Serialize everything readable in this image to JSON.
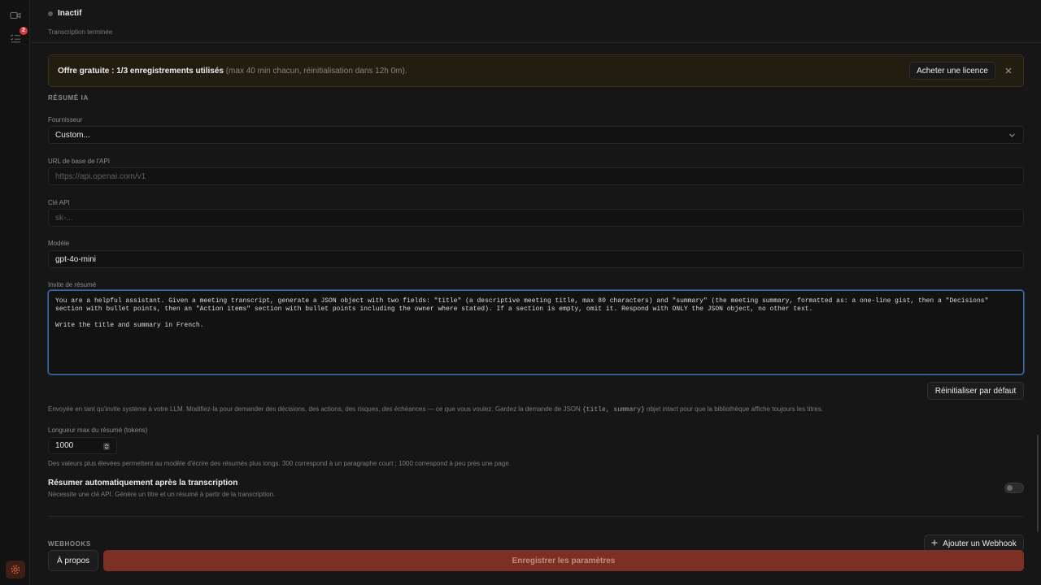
{
  "rail": {
    "icons": [
      "video-icon",
      "list-checks-icon",
      "settings-icon"
    ],
    "badge_count": "2"
  },
  "status": {
    "label": "Inactif",
    "sub": "Transcription terminée"
  },
  "banner": {
    "bold_text": "Offre gratuite : 1/3 enregistrements utilisés",
    "muted_text": " (max 40 min chacun, réinitialisation dans 12h 0m).",
    "button_label": "Acheter une licence"
  },
  "ai_summary": {
    "section_title": "RÉSUMÉ IA",
    "provider": {
      "label": "Fournisseur",
      "value": "Custom..."
    },
    "base_url": {
      "label": "URL de base de l'API",
      "placeholder": "https://api.openai.com/v1"
    },
    "api_key": {
      "label": "Clé API",
      "placeholder": "sk-..."
    },
    "model": {
      "label": "Modèle",
      "value": "gpt-4o-mini"
    },
    "prompt": {
      "label": "Invite de résumé",
      "value": "You are a helpful assistant. Given a meeting transcript, generate a JSON object with two fields: \"title\" (a descriptive meeting title, max 80 characters) and \"summary\" (the meeting summary, formatted as: a one-line gist, then a \"Decisions\"\nsection with bullet points, then an \"Action items\" section with bullet points including the owner where stated). If a section is empty, omit it. Respond with ONLY the JSON object, no other text.\n\nWrite the title and summary in French."
    },
    "reset_label": "Réinitialiser par défaut",
    "prompt_help_before": "Envoyée en tant qu'invite système à votre LLM. Modifiez-la pour demander des décisions, des actions, des risques, des échéances — ce que vous voulez. Gardez la demande de JSON ",
    "prompt_help_code": "{title, summary}",
    "prompt_help_after": " objet intact pour que la bibliothèque affiche toujours les titres.",
    "max_length": {
      "label": "Longueur max du résumé (tokens)",
      "value": "1000"
    },
    "max_length_help": "Des valeurs plus élevées permettent au modèle d'écrire des résumés plus longs. 300 correspond à un paragraphe court ; 1000 correspond à peu près une page.",
    "auto": {
      "title": "Résumer automatiquement après la transcription",
      "sub": "Nécessite une clé API. Génère un titre et un résumé à partir de la transcription.",
      "enabled": false
    }
  },
  "webhooks": {
    "section_title": "WEBHOOKS",
    "add_label": "Ajouter un Webhook"
  },
  "footer": {
    "about_label": "À propos",
    "save_label": "Enregistrer les paramètres"
  }
}
